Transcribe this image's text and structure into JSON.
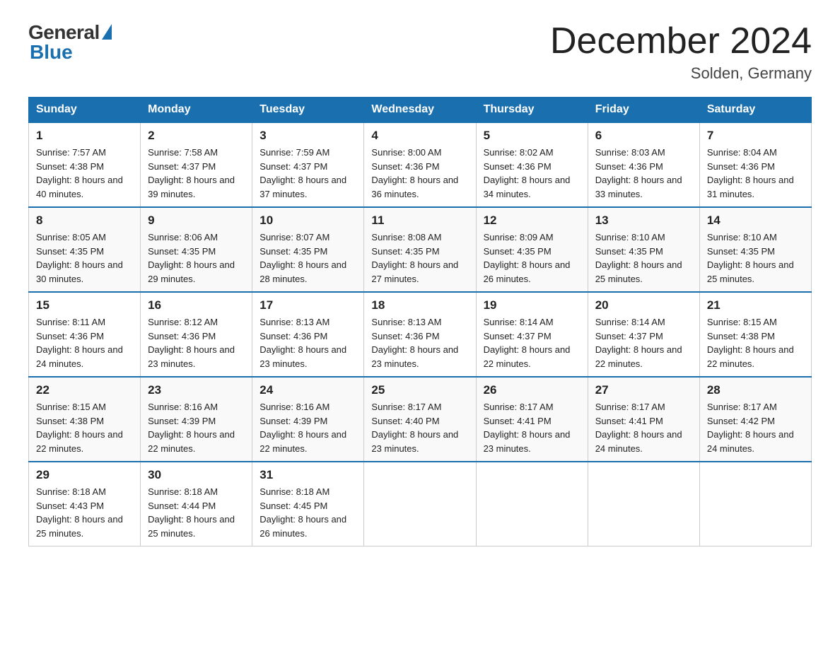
{
  "header": {
    "logo_general": "General",
    "logo_blue": "Blue",
    "title": "December 2024",
    "subtitle": "Solden, Germany"
  },
  "calendar": {
    "days_of_week": [
      "Sunday",
      "Monday",
      "Tuesday",
      "Wednesday",
      "Thursday",
      "Friday",
      "Saturday"
    ],
    "weeks": [
      [
        {
          "day": "1",
          "sunrise": "7:57 AM",
          "sunset": "4:38 PM",
          "daylight": "8 hours and 40 minutes."
        },
        {
          "day": "2",
          "sunrise": "7:58 AM",
          "sunset": "4:37 PM",
          "daylight": "8 hours and 39 minutes."
        },
        {
          "day": "3",
          "sunrise": "7:59 AM",
          "sunset": "4:37 PM",
          "daylight": "8 hours and 37 minutes."
        },
        {
          "day": "4",
          "sunrise": "8:00 AM",
          "sunset": "4:36 PM",
          "daylight": "8 hours and 36 minutes."
        },
        {
          "day": "5",
          "sunrise": "8:02 AM",
          "sunset": "4:36 PM",
          "daylight": "8 hours and 34 minutes."
        },
        {
          "day": "6",
          "sunrise": "8:03 AM",
          "sunset": "4:36 PM",
          "daylight": "8 hours and 33 minutes."
        },
        {
          "day": "7",
          "sunrise": "8:04 AM",
          "sunset": "4:36 PM",
          "daylight": "8 hours and 31 minutes."
        }
      ],
      [
        {
          "day": "8",
          "sunrise": "8:05 AM",
          "sunset": "4:35 PM",
          "daylight": "8 hours and 30 minutes."
        },
        {
          "day": "9",
          "sunrise": "8:06 AM",
          "sunset": "4:35 PM",
          "daylight": "8 hours and 29 minutes."
        },
        {
          "day": "10",
          "sunrise": "8:07 AM",
          "sunset": "4:35 PM",
          "daylight": "8 hours and 28 minutes."
        },
        {
          "day": "11",
          "sunrise": "8:08 AM",
          "sunset": "4:35 PM",
          "daylight": "8 hours and 27 minutes."
        },
        {
          "day": "12",
          "sunrise": "8:09 AM",
          "sunset": "4:35 PM",
          "daylight": "8 hours and 26 minutes."
        },
        {
          "day": "13",
          "sunrise": "8:10 AM",
          "sunset": "4:35 PM",
          "daylight": "8 hours and 25 minutes."
        },
        {
          "day": "14",
          "sunrise": "8:10 AM",
          "sunset": "4:35 PM",
          "daylight": "8 hours and 25 minutes."
        }
      ],
      [
        {
          "day": "15",
          "sunrise": "8:11 AM",
          "sunset": "4:36 PM",
          "daylight": "8 hours and 24 minutes."
        },
        {
          "day": "16",
          "sunrise": "8:12 AM",
          "sunset": "4:36 PM",
          "daylight": "8 hours and 23 minutes."
        },
        {
          "day": "17",
          "sunrise": "8:13 AM",
          "sunset": "4:36 PM",
          "daylight": "8 hours and 23 minutes."
        },
        {
          "day": "18",
          "sunrise": "8:13 AM",
          "sunset": "4:36 PM",
          "daylight": "8 hours and 23 minutes."
        },
        {
          "day": "19",
          "sunrise": "8:14 AM",
          "sunset": "4:37 PM",
          "daylight": "8 hours and 22 minutes."
        },
        {
          "day": "20",
          "sunrise": "8:14 AM",
          "sunset": "4:37 PM",
          "daylight": "8 hours and 22 minutes."
        },
        {
          "day": "21",
          "sunrise": "8:15 AM",
          "sunset": "4:38 PM",
          "daylight": "8 hours and 22 minutes."
        }
      ],
      [
        {
          "day": "22",
          "sunrise": "8:15 AM",
          "sunset": "4:38 PM",
          "daylight": "8 hours and 22 minutes."
        },
        {
          "day": "23",
          "sunrise": "8:16 AM",
          "sunset": "4:39 PM",
          "daylight": "8 hours and 22 minutes."
        },
        {
          "day": "24",
          "sunrise": "8:16 AM",
          "sunset": "4:39 PM",
          "daylight": "8 hours and 22 minutes."
        },
        {
          "day": "25",
          "sunrise": "8:17 AM",
          "sunset": "4:40 PM",
          "daylight": "8 hours and 23 minutes."
        },
        {
          "day": "26",
          "sunrise": "8:17 AM",
          "sunset": "4:41 PM",
          "daylight": "8 hours and 23 minutes."
        },
        {
          "day": "27",
          "sunrise": "8:17 AM",
          "sunset": "4:41 PM",
          "daylight": "8 hours and 24 minutes."
        },
        {
          "day": "28",
          "sunrise": "8:17 AM",
          "sunset": "4:42 PM",
          "daylight": "8 hours and 24 minutes."
        }
      ],
      [
        {
          "day": "29",
          "sunrise": "8:18 AM",
          "sunset": "4:43 PM",
          "daylight": "8 hours and 25 minutes."
        },
        {
          "day": "30",
          "sunrise": "8:18 AM",
          "sunset": "4:44 PM",
          "daylight": "8 hours and 25 minutes."
        },
        {
          "day": "31",
          "sunrise": "8:18 AM",
          "sunset": "4:45 PM",
          "daylight": "8 hours and 26 minutes."
        },
        null,
        null,
        null,
        null
      ]
    ]
  }
}
